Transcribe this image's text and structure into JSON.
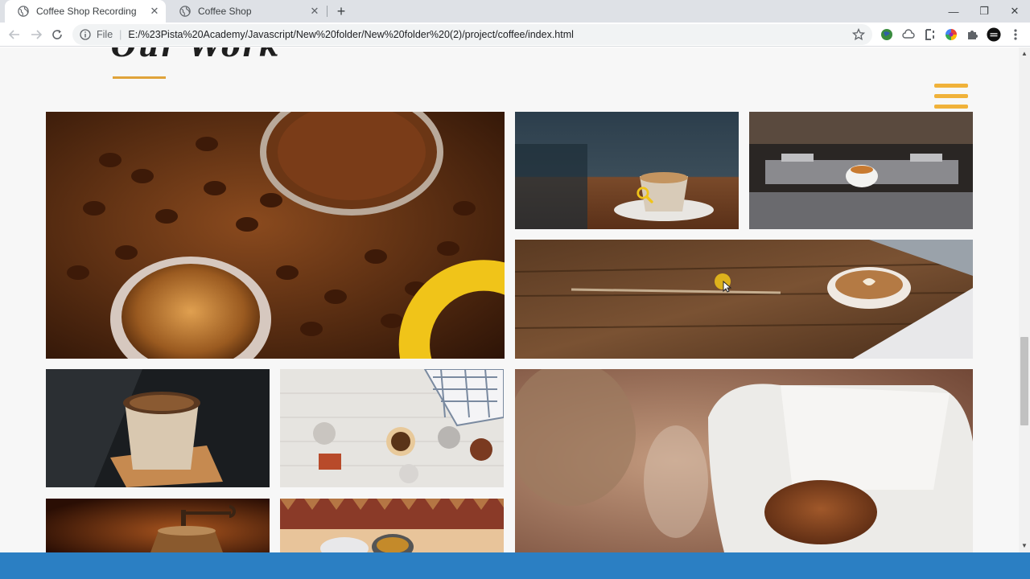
{
  "browser": {
    "tabs": [
      {
        "title": "Coffee Shop Recording",
        "active": true
      },
      {
        "title": "Coffee Shop",
        "active": false
      }
    ],
    "new_tab_label": "+",
    "window_controls": {
      "minimize": "—",
      "maximize": "❐",
      "close": "✕"
    },
    "address": {
      "scheme_label": "File",
      "url": "E:/%23Pista%20Academy/Javascript/New%20folder/New%20folder%20(2)/project/coffee/index.html"
    }
  },
  "page": {
    "heading_partial": "Our Work",
    "accent_color": "#e0a33a",
    "menu_icon": "hamburger-menu-icon",
    "gallery": [
      {
        "subject": "coffee beans, ground coffee and espresso cup",
        "hover": true
      },
      {
        "subject": "latte on cafe table",
        "hover": true
      },
      {
        "subject": "espresso machine pouring",
        "hover": false
      },
      {
        "subject": "latte art on wooden desk with laptop",
        "hover": false
      },
      {
        "subject": "takeaway coffee cup on coaster",
        "hover": false
      },
      {
        "subject": "coffee brewing tools flat lay",
        "hover": false
      },
      {
        "subject": "pour-over filter with ground coffee",
        "hover": false
      },
      {
        "subject": "vintage coffee grinder",
        "hover": false
      },
      {
        "subject": "coffee cups on patterned cloth",
        "hover": false
      }
    ]
  },
  "colors": {
    "tab_strip": "#dee1e6",
    "omnibox": "#f1f3f4",
    "bottom_bar": "#2b7fc3",
    "highlight_yellow": "#f0c419"
  }
}
